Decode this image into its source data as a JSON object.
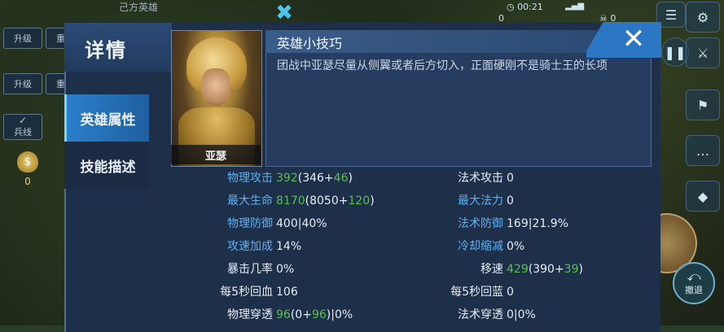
{
  "hud": {
    "team_title": "己方英雄",
    "buttons": [
      "升级",
      "重置",
      "升级",
      "重置"
    ],
    "minion_label": "兵线",
    "gold": "0",
    "time": "00:21",
    "kills": "0",
    "score": "0",
    "retreat_label": "撤退"
  },
  "panel": {
    "title": "详情",
    "tabs": [
      {
        "label": "英雄属性",
        "active": true
      },
      {
        "label": "技能描述",
        "active": false
      }
    ],
    "hero_name": "亚瑟",
    "tip_title": "英雄小技巧",
    "tip_text": "团战中亚瑟尽量从侧翼或者后方切入，正面硬刚不是骑士王的长项"
  },
  "stats": [
    {
      "label": "物理攻击",
      "color": "blue",
      "parts": [
        [
          "392",
          "g"
        ],
        [
          "(346+",
          "w"
        ],
        [
          "46",
          "g"
        ],
        [
          ")",
          "w"
        ]
      ]
    },
    {
      "label": "法术攻击",
      "color": "white",
      "parts": [
        [
          "0",
          "w"
        ]
      ]
    },
    {
      "label": "最大生命",
      "color": "blue",
      "parts": [
        [
          "8170",
          "g"
        ],
        [
          "(8050+",
          "w"
        ],
        [
          "120",
          "g"
        ],
        [
          ")",
          "w"
        ]
      ]
    },
    {
      "label": "最大法力",
      "color": "blue",
      "parts": [
        [
          "0",
          "w"
        ]
      ]
    },
    {
      "label": "物理防御",
      "color": "blue",
      "parts": [
        [
          "400|40%",
          "w"
        ]
      ]
    },
    {
      "label": "法术防御",
      "color": "blue",
      "parts": [
        [
          "169|21.9%",
          "w"
        ]
      ]
    },
    {
      "label": "攻速加成",
      "color": "blue",
      "parts": [
        [
          "14%",
          "w"
        ]
      ]
    },
    {
      "label": "冷却缩减",
      "color": "blue",
      "parts": [
        [
          "0%",
          "w"
        ]
      ]
    },
    {
      "label": "暴击几率",
      "color": "white",
      "parts": [
        [
          "0%",
          "w"
        ]
      ]
    },
    {
      "label": "移速",
      "color": "white",
      "parts": [
        [
          "429",
          "g"
        ],
        [
          "(390+",
          "w"
        ],
        [
          "39",
          "g"
        ],
        [
          ")",
          "w"
        ]
      ]
    },
    {
      "label": "每5秒回血",
      "color": "white",
      "parts": [
        [
          "106",
          "w"
        ]
      ]
    },
    {
      "label": "每5秒回蓝",
      "color": "white",
      "parts": [
        [
          "0",
          "w"
        ]
      ]
    },
    {
      "label": "物理穿透",
      "color": "white",
      "parts": [
        [
          "96",
          "g"
        ],
        [
          "(0+",
          "w"
        ],
        [
          "96",
          "g"
        ],
        [
          ")|0%",
          "w"
        ]
      ]
    },
    {
      "label": "法术穿透",
      "color": "white",
      "parts": [
        [
          "0|0%",
          "w"
        ]
      ]
    }
  ],
  "colors": {
    "label_blue": "#5fb0f0",
    "bonus_green": "#55c34d",
    "tab_active": "#2a7fc9"
  }
}
